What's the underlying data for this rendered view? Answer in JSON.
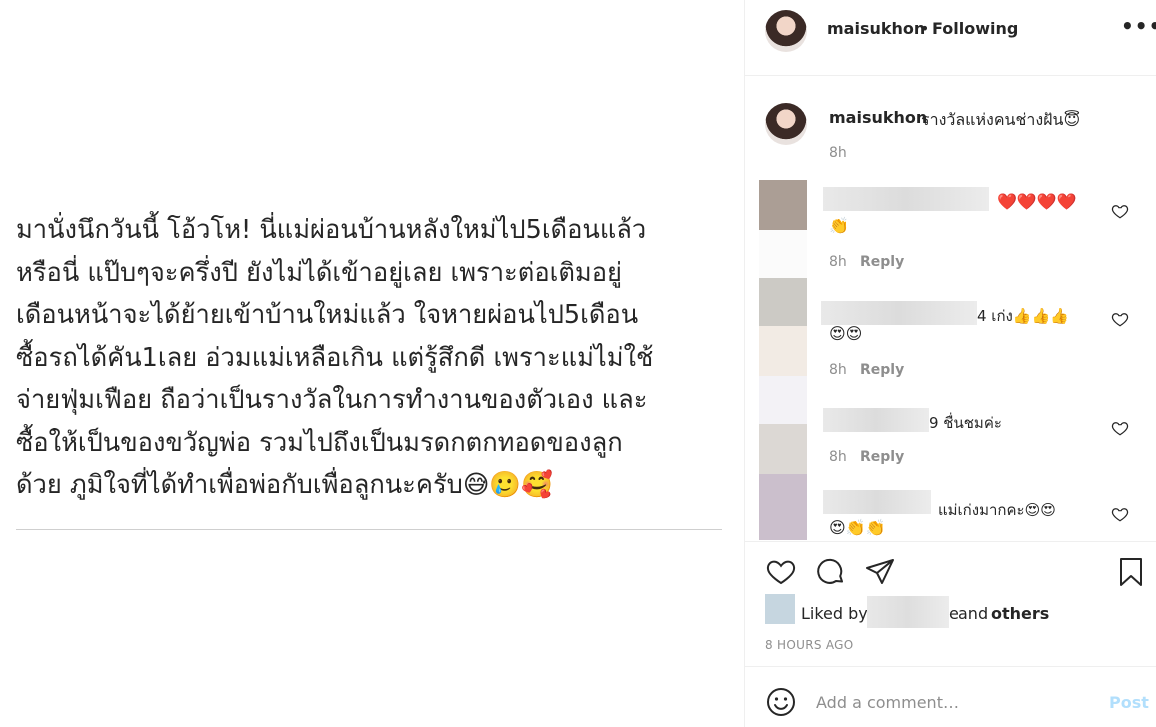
{
  "post": {
    "text": "มานั่งนึกวันนี้ โอ้วโห! นี่แม่ผ่อนบ้านหลังใหม่ไป5เดือนแล้ว\nหรือนี่ แป๊บๆจะครึ่งปี ยังไม่ได้เข้าอยู่เลย เพราะต่อเติมอยู่\nเดือนหน้าจะได้ย้ายเข้าบ้านใหม่แล้ว ใจหายผ่อนไป5เดือน\nซื้อรถได้คัน1เลย อ่วมแม่เหลือเกิน แต่รู้สึกดี เพราะแม่ไม่ใช้\nจ่ายฟุ่มเฟือย ถือว่าเป็นรางวัลในการทำงานของตัวเอง และ\nซื้อให้เป็นของขวัญพ่อ รวมไปถึงเป็นมรดกตกทอดของลูก\nด้วย ภูมิใจที่ได้ทำเพื่อพ่อกับเพื่อลูกนะครับ😅🥲🥰"
  },
  "header": {
    "username": "maisukhon",
    "separator": "•",
    "following": "Following",
    "more_icon": "more-options-icon"
  },
  "caption": {
    "username": "maisukhon",
    "text": "รางวัลแห่งคนช่างฝัน😇",
    "time": "8h"
  },
  "comments": [
    {
      "tail": "",
      "emoji": "❤️❤️❤️❤️",
      "emoji2": "👏",
      "time": "8h",
      "reply": "Reply"
    },
    {
      "tail": "4 เก่ง👍👍👍",
      "emoji": "",
      "emoji2": "😍😍",
      "time": "8h",
      "reply": "Reply"
    },
    {
      "tail": "9 ชื่นชมค่ะ",
      "emoji": "",
      "emoji2": "",
      "time": "8h",
      "reply": "Reply"
    },
    {
      "tail": "แม่เก่งมากคะ😍😍",
      "emoji": "",
      "emoji2": "😍👏👏",
      "time": "",
      "reply": ""
    }
  ],
  "likes": {
    "liked_by": "Liked by",
    "name_tail": "e",
    "and": "and",
    "others": "others",
    "time": "8 HOURS AGO"
  },
  "comment_box": {
    "placeholder": "Add a comment…",
    "post_label": "Post"
  },
  "icons": [
    "heart-icon",
    "comment-icon",
    "share-icon",
    "bookmark-icon",
    "smiley-icon"
  ],
  "colors": {
    "text": "#262626",
    "muted": "#8e8e8e",
    "post_button": "#b2dffc",
    "divider": "#efefef"
  }
}
